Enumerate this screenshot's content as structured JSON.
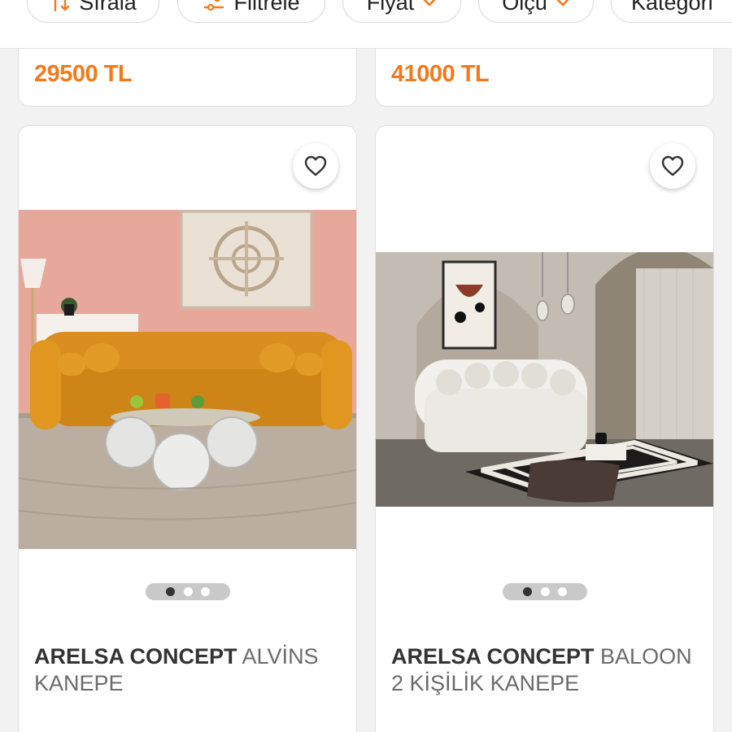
{
  "filter_bar": {
    "chips": [
      {
        "label": "Sırala",
        "icon": "sort-arrows-icon"
      },
      {
        "label": "Filtrele",
        "icon": "filter-sliders-icon"
      },
      {
        "label": "Fiyat",
        "icon": "chevron-down-icon"
      },
      {
        "label": "Ölçü",
        "icon": "chevron-down-icon"
      },
      {
        "label": "Kategori",
        "icon": ""
      }
    ]
  },
  "top_cards": [
    {
      "price": "29500 TL"
    },
    {
      "price": "41000 TL"
    }
  ],
  "products": [
    {
      "brand": "ARELSA CONCEPT",
      "name": "ALVİNS KANEPE",
      "image": "orange-boucle-sofa-pink-wall",
      "carousel": {
        "count": 3,
        "active": 1
      }
    },
    {
      "brand": "ARELSA CONCEPT",
      "name": "BALOON 2 KİŞİLİK KANEPE",
      "image": "white-bubble-sofa-arched-room",
      "carousel": {
        "count": 3,
        "active": 1
      }
    }
  ],
  "colors": {
    "accent": "#f27a1a",
    "brand_text": "#333333",
    "name_text": "#6b6b6b",
    "background": "#f2f2f2"
  }
}
